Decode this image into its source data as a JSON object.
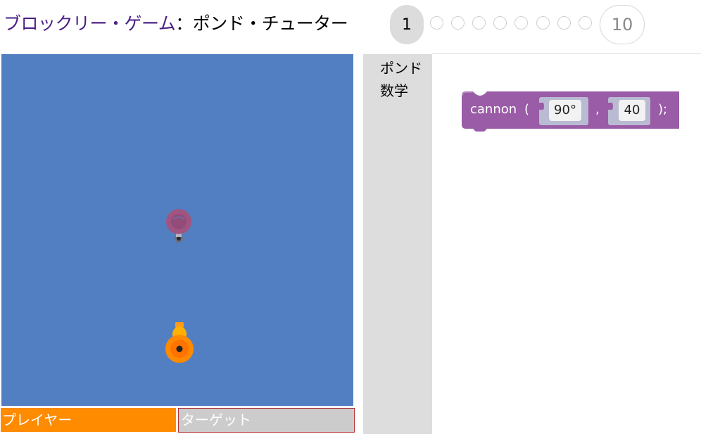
{
  "header": {
    "game_link": "ブロックリー・ゲーム",
    "separator": "：",
    "app_name": "ポンド・チューター",
    "levels": {
      "current": "1",
      "last": "10",
      "total": 10,
      "current_index": 1
    }
  },
  "playfield": {
    "background_color": "#527fc1",
    "avatars": [
      {
        "role": "target",
        "color": "#a8517a",
        "icon": "duck-target-icon"
      },
      {
        "role": "player",
        "color": "#ff8a00",
        "icon": "duck-player-icon"
      }
    ]
  },
  "players": {
    "player_label": "プレイヤー",
    "target_label": "ターゲット",
    "player_color": "#ff8b00",
    "target_color": "#cccccc"
  },
  "toolbox": {
    "categories": [
      "ポンド",
      "数学"
    ]
  },
  "workspace": {
    "block": {
      "color": "#9a5ca6",
      "keyword": "cannon",
      "open_paren": "(",
      "comma": ",",
      "close": ");",
      "angle": "90°",
      "range": "40"
    }
  }
}
